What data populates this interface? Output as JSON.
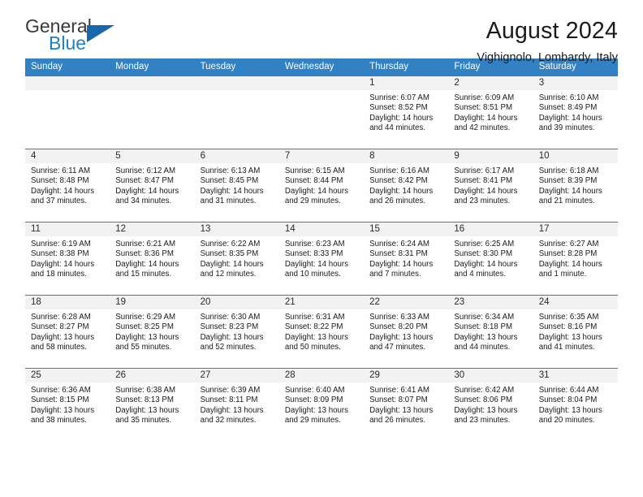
{
  "brand": {
    "name_top": "General",
    "name_bottom": "Blue",
    "triangle_color": "#1667ab",
    "blue_color": "#1f7fc4",
    "gray_color": "#3a3a3a"
  },
  "header": {
    "title": "August 2024",
    "subtitle": "Vighignolo, Lombardy, Italy"
  },
  "colors": {
    "header_blue": "#3181c4",
    "date_band": "#f2f2f2",
    "text": "#1a1a1a"
  },
  "weekdays": [
    "Sunday",
    "Monday",
    "Tuesday",
    "Wednesday",
    "Thursday",
    "Friday",
    "Saturday"
  ],
  "labels": {
    "sunrise": "Sunrise:",
    "sunset": "Sunset:",
    "daylight": "Daylight:"
  },
  "weeks": [
    [
      {
        "date": "",
        "empty": true
      },
      {
        "date": "",
        "empty": true
      },
      {
        "date": "",
        "empty": true
      },
      {
        "date": "",
        "empty": true
      },
      {
        "date": "1",
        "sunrise": "Sunrise: 6:07 AM",
        "sunset": "Sunset: 8:52 PM",
        "daylight1": "Daylight: 14 hours",
        "daylight2": "and 44 minutes."
      },
      {
        "date": "2",
        "sunrise": "Sunrise: 6:09 AM",
        "sunset": "Sunset: 8:51 PM",
        "daylight1": "Daylight: 14 hours",
        "daylight2": "and 42 minutes."
      },
      {
        "date": "3",
        "sunrise": "Sunrise: 6:10 AM",
        "sunset": "Sunset: 8:49 PM",
        "daylight1": "Daylight: 14 hours",
        "daylight2": "and 39 minutes."
      }
    ],
    [
      {
        "date": "4",
        "sunrise": "Sunrise: 6:11 AM",
        "sunset": "Sunset: 8:48 PM",
        "daylight1": "Daylight: 14 hours",
        "daylight2": "and 37 minutes."
      },
      {
        "date": "5",
        "sunrise": "Sunrise: 6:12 AM",
        "sunset": "Sunset: 8:47 PM",
        "daylight1": "Daylight: 14 hours",
        "daylight2": "and 34 minutes."
      },
      {
        "date": "6",
        "sunrise": "Sunrise: 6:13 AM",
        "sunset": "Sunset: 8:45 PM",
        "daylight1": "Daylight: 14 hours",
        "daylight2": "and 31 minutes."
      },
      {
        "date": "7",
        "sunrise": "Sunrise: 6:15 AM",
        "sunset": "Sunset: 8:44 PM",
        "daylight1": "Daylight: 14 hours",
        "daylight2": "and 29 minutes."
      },
      {
        "date": "8",
        "sunrise": "Sunrise: 6:16 AM",
        "sunset": "Sunset: 8:42 PM",
        "daylight1": "Daylight: 14 hours",
        "daylight2": "and 26 minutes."
      },
      {
        "date": "9",
        "sunrise": "Sunrise: 6:17 AM",
        "sunset": "Sunset: 8:41 PM",
        "daylight1": "Daylight: 14 hours",
        "daylight2": "and 23 minutes."
      },
      {
        "date": "10",
        "sunrise": "Sunrise: 6:18 AM",
        "sunset": "Sunset: 8:39 PM",
        "daylight1": "Daylight: 14 hours",
        "daylight2": "and 21 minutes."
      }
    ],
    [
      {
        "date": "11",
        "sunrise": "Sunrise: 6:19 AM",
        "sunset": "Sunset: 8:38 PM",
        "daylight1": "Daylight: 14 hours",
        "daylight2": "and 18 minutes."
      },
      {
        "date": "12",
        "sunrise": "Sunrise: 6:21 AM",
        "sunset": "Sunset: 8:36 PM",
        "daylight1": "Daylight: 14 hours",
        "daylight2": "and 15 minutes."
      },
      {
        "date": "13",
        "sunrise": "Sunrise: 6:22 AM",
        "sunset": "Sunset: 8:35 PM",
        "daylight1": "Daylight: 14 hours",
        "daylight2": "and 12 minutes."
      },
      {
        "date": "14",
        "sunrise": "Sunrise: 6:23 AM",
        "sunset": "Sunset: 8:33 PM",
        "daylight1": "Daylight: 14 hours",
        "daylight2": "and 10 minutes."
      },
      {
        "date": "15",
        "sunrise": "Sunrise: 6:24 AM",
        "sunset": "Sunset: 8:31 PM",
        "daylight1": "Daylight: 14 hours",
        "daylight2": "and 7 minutes."
      },
      {
        "date": "16",
        "sunrise": "Sunrise: 6:25 AM",
        "sunset": "Sunset: 8:30 PM",
        "daylight1": "Daylight: 14 hours",
        "daylight2": "and 4 minutes."
      },
      {
        "date": "17",
        "sunrise": "Sunrise: 6:27 AM",
        "sunset": "Sunset: 8:28 PM",
        "daylight1": "Daylight: 14 hours",
        "daylight2": "and 1 minute."
      }
    ],
    [
      {
        "date": "18",
        "sunrise": "Sunrise: 6:28 AM",
        "sunset": "Sunset: 8:27 PM",
        "daylight1": "Daylight: 13 hours",
        "daylight2": "and 58 minutes."
      },
      {
        "date": "19",
        "sunrise": "Sunrise: 6:29 AM",
        "sunset": "Sunset: 8:25 PM",
        "daylight1": "Daylight: 13 hours",
        "daylight2": "and 55 minutes."
      },
      {
        "date": "20",
        "sunrise": "Sunrise: 6:30 AM",
        "sunset": "Sunset: 8:23 PM",
        "daylight1": "Daylight: 13 hours",
        "daylight2": "and 52 minutes."
      },
      {
        "date": "21",
        "sunrise": "Sunrise: 6:31 AM",
        "sunset": "Sunset: 8:22 PM",
        "daylight1": "Daylight: 13 hours",
        "daylight2": "and 50 minutes."
      },
      {
        "date": "22",
        "sunrise": "Sunrise: 6:33 AM",
        "sunset": "Sunset: 8:20 PM",
        "daylight1": "Daylight: 13 hours",
        "daylight2": "and 47 minutes."
      },
      {
        "date": "23",
        "sunrise": "Sunrise: 6:34 AM",
        "sunset": "Sunset: 8:18 PM",
        "daylight1": "Daylight: 13 hours",
        "daylight2": "and 44 minutes."
      },
      {
        "date": "24",
        "sunrise": "Sunrise: 6:35 AM",
        "sunset": "Sunset: 8:16 PM",
        "daylight1": "Daylight: 13 hours",
        "daylight2": "and 41 minutes."
      }
    ],
    [
      {
        "date": "25",
        "sunrise": "Sunrise: 6:36 AM",
        "sunset": "Sunset: 8:15 PM",
        "daylight1": "Daylight: 13 hours",
        "daylight2": "and 38 minutes."
      },
      {
        "date": "26",
        "sunrise": "Sunrise: 6:38 AM",
        "sunset": "Sunset: 8:13 PM",
        "daylight1": "Daylight: 13 hours",
        "daylight2": "and 35 minutes."
      },
      {
        "date": "27",
        "sunrise": "Sunrise: 6:39 AM",
        "sunset": "Sunset: 8:11 PM",
        "daylight1": "Daylight: 13 hours",
        "daylight2": "and 32 minutes."
      },
      {
        "date": "28",
        "sunrise": "Sunrise: 6:40 AM",
        "sunset": "Sunset: 8:09 PM",
        "daylight1": "Daylight: 13 hours",
        "daylight2": "and 29 minutes."
      },
      {
        "date": "29",
        "sunrise": "Sunrise: 6:41 AM",
        "sunset": "Sunset: 8:07 PM",
        "daylight1": "Daylight: 13 hours",
        "daylight2": "and 26 minutes."
      },
      {
        "date": "30",
        "sunrise": "Sunrise: 6:42 AM",
        "sunset": "Sunset: 8:06 PM",
        "daylight1": "Daylight: 13 hours",
        "daylight2": "and 23 minutes."
      },
      {
        "date": "31",
        "sunrise": "Sunrise: 6:44 AM",
        "sunset": "Sunset: 8:04 PM",
        "daylight1": "Daylight: 13 hours",
        "daylight2": "and 20 minutes."
      }
    ]
  ]
}
